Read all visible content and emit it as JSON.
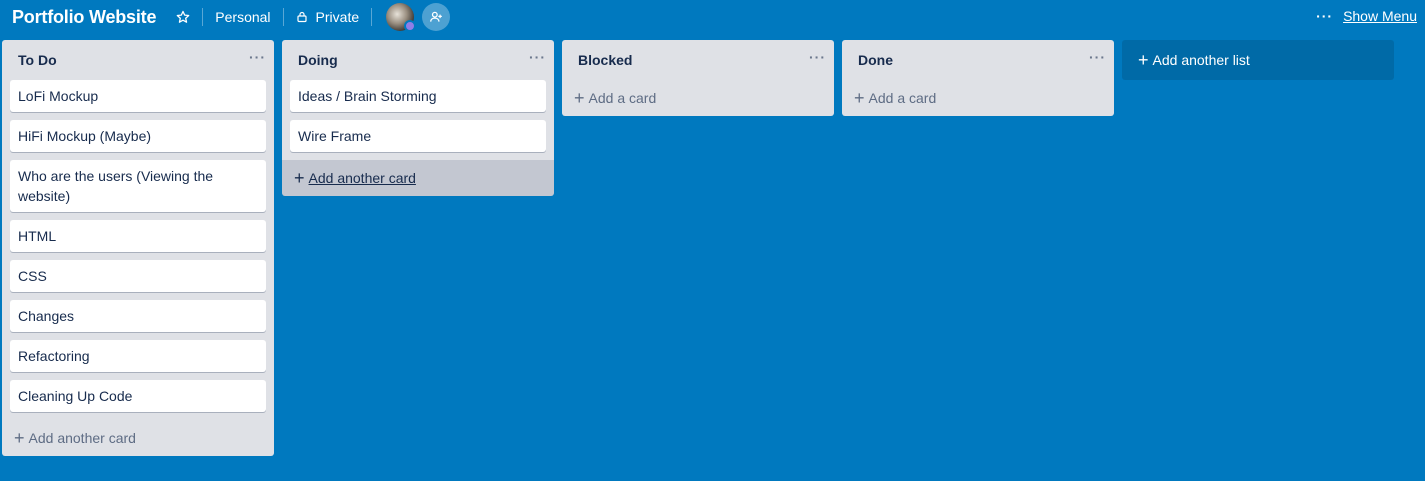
{
  "board": {
    "title": "Portfolio Website",
    "team_label": "Personal",
    "visibility_label": "Private",
    "show_menu_label": "Show Menu",
    "more_icon_text": "···"
  },
  "lists": [
    {
      "title": "To Do",
      "cards": [
        "LoFi Mockup",
        "HiFi Mockup (Maybe)",
        "Who are the users (Viewing the website)",
        "HTML",
        "CSS",
        "Changes",
        "Refactoring",
        "Cleaning Up Code"
      ],
      "add_label": "Add another card"
    },
    {
      "title": "Doing",
      "cards": [
        "Ideas / Brain Storming",
        "Wire Frame"
      ],
      "add_label": "Add another card"
    },
    {
      "title": "Blocked",
      "cards": [],
      "add_label": "Add a card"
    },
    {
      "title": "Done",
      "cards": [],
      "add_label": "Add a card"
    }
  ],
  "add_list_label": "Add another list",
  "list_menu_text": "···",
  "plus_glyph": "+",
  "colors": {
    "board_bg": "#0079bf",
    "list_bg": "#dfe1e6",
    "card_bg": "#ffffff",
    "text": "#172b4d",
    "muted": "#5e6c84"
  }
}
